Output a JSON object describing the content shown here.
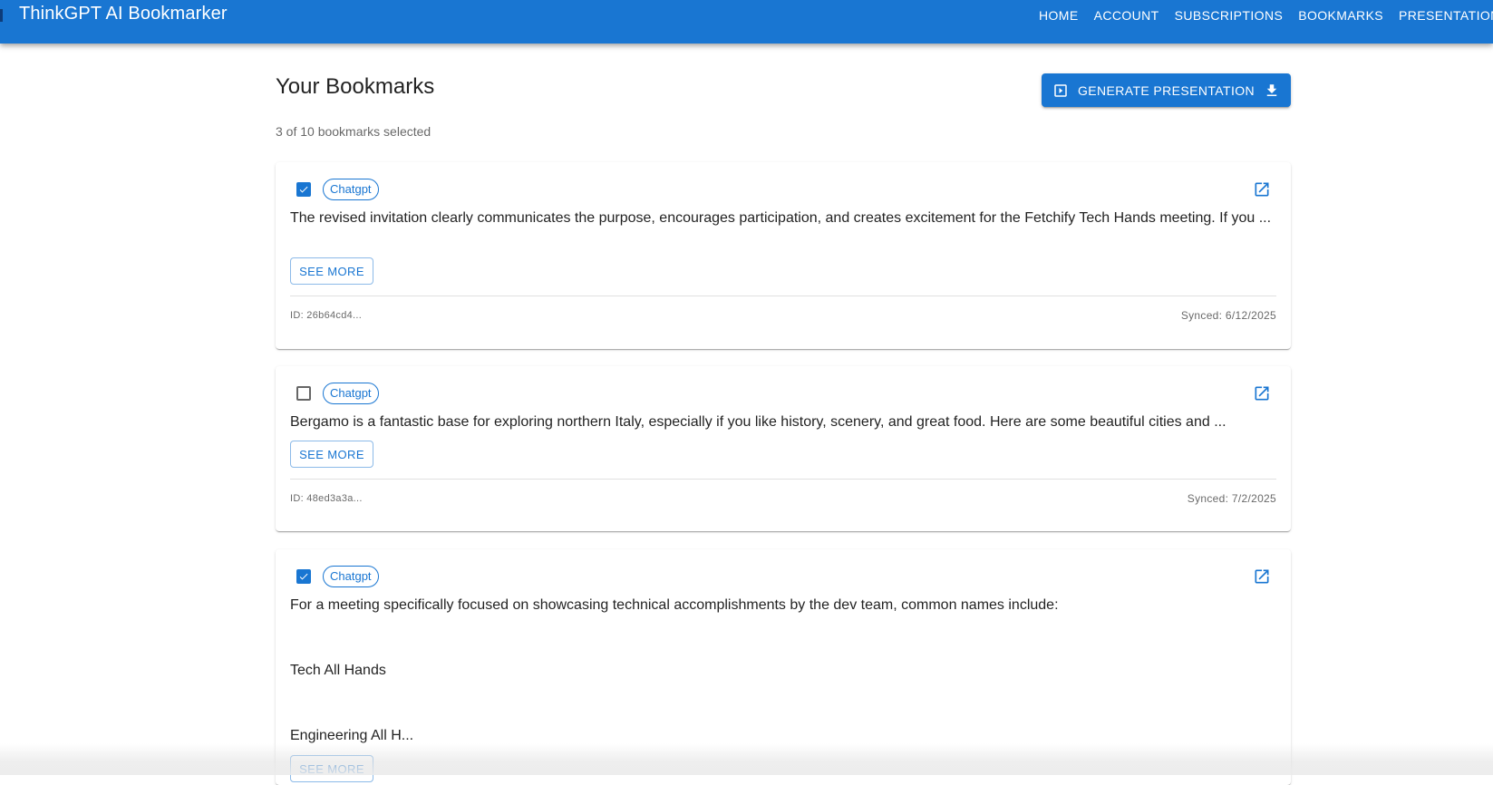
{
  "app": {
    "title": "ThinkGPT AI Bookmarker"
  },
  "nav": [
    "HOME",
    "ACCOUNT",
    "SUBSCRIPTIONS",
    "BOOKMARKS",
    "PRESENTATIONS"
  ],
  "header": {
    "title": "Your Bookmarks",
    "selection_count": "3 of 10 bookmarks selected",
    "generate_label": "GENERATE PRESENTATION"
  },
  "bookmarks": [
    {
      "checked": true,
      "tag": "Chatgpt",
      "text": "The revised invitation clearly communicates the purpose, encourages participation, and creates excitement for the Fetchify Tech Hands meeting. If you ...",
      "see_more": "SEE MORE",
      "id": "ID: 26b64cd4...",
      "synced": "Synced: 6/12/2025"
    },
    {
      "checked": false,
      "tag": "Chatgpt",
      "text": "Bergamo is a fantastic base for exploring northern Italy, especially if you like history, scenery, and great food. Here are some beautiful cities and ...",
      "see_more": "SEE MORE",
      "id": "ID: 48ed3a3a...",
      "synced": "Synced: 7/2/2025"
    },
    {
      "checked": true,
      "tag": "Chatgpt",
      "text_lines": [
        "For a meeting specifically focused on showcasing technical accomplishments by the dev team, common names include:",
        "Tech All Hands",
        "Engineering All H..."
      ],
      "see_more": "SEE MORE"
    }
  ],
  "colors": {
    "primary": "#1976d2",
    "text": "#212121",
    "muted": "#666666"
  }
}
